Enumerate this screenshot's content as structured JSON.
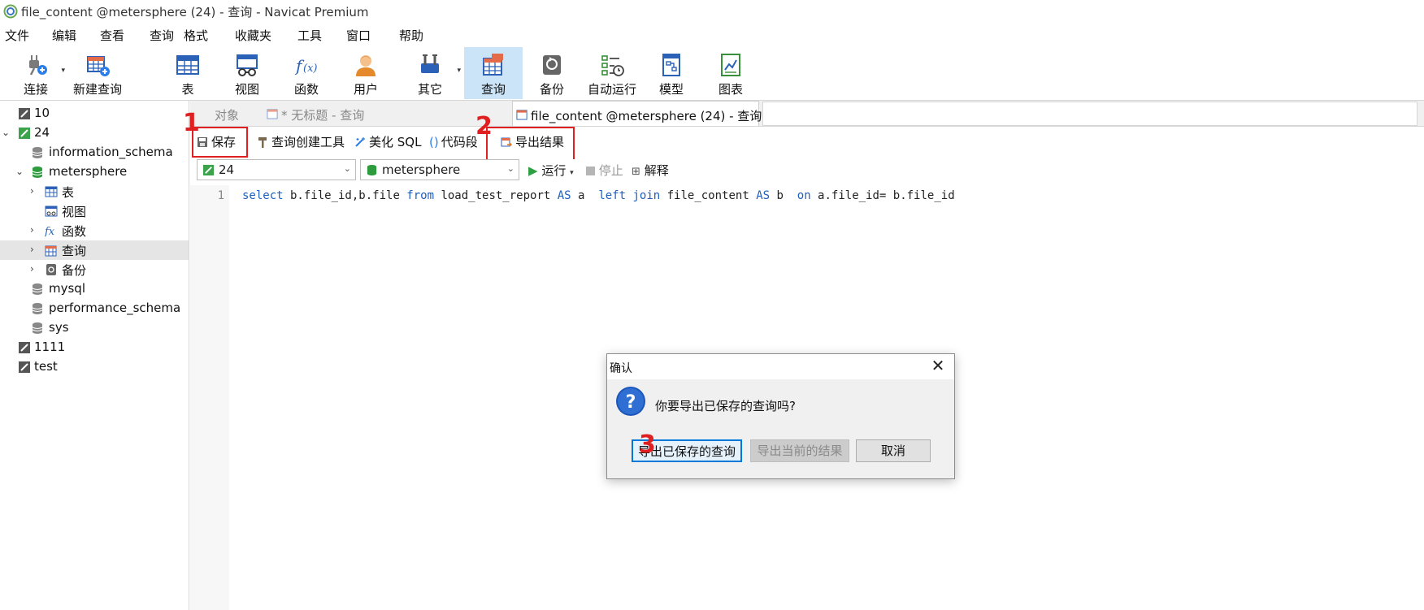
{
  "window": {
    "title": "file_content @metersphere (24) - 查询 - Navicat Premium"
  },
  "menu": [
    "文件",
    "编辑",
    "查看",
    "查询",
    "格式",
    "收藏夹",
    "工具",
    "窗口",
    "帮助"
  ],
  "toolbar": {
    "connect": "连接",
    "new_query": "新建查询",
    "table": "表",
    "view": "视图",
    "function": "函数",
    "user": "用户",
    "other": "其它",
    "query": "查询",
    "backup": "备份",
    "automation": "自动运行",
    "model": "模型",
    "chart": "图表"
  },
  "sidebar": {
    "items": [
      {
        "label": "10"
      },
      {
        "label": "24"
      },
      {
        "label": "information_schema"
      },
      {
        "label": "metersphere"
      },
      {
        "label": "表"
      },
      {
        "label": "视图"
      },
      {
        "label": "函数"
      },
      {
        "label": "查询"
      },
      {
        "label": "备份"
      },
      {
        "label": "mysql"
      },
      {
        "label": "performance_schema"
      },
      {
        "label": "sys"
      },
      {
        "label": "1111"
      },
      {
        "label": "test"
      }
    ]
  },
  "tabs": {
    "objects": "对象",
    "untitled": "* 无标题 - 查询",
    "current": "file_content @metersphere (24) - 查询"
  },
  "editor_toolbar": {
    "save": "保存",
    "query_builder": "查询创建工具",
    "beautify": "美化 SQL",
    "snippet": "代码段",
    "export": "导出结果"
  },
  "selectors": {
    "connection": "24",
    "database": "metersphere",
    "run": "运行",
    "stop": "停止",
    "explain": "解释"
  },
  "editor": {
    "line_number": "1",
    "code_tokens": [
      {
        "t": "select",
        "k": true
      },
      {
        "t": " b.file_id,b.file ",
        "k": false
      },
      {
        "t": "from",
        "k": true
      },
      {
        "t": " load_test_report ",
        "k": false
      },
      {
        "t": "AS",
        "k": true
      },
      {
        "t": " a  ",
        "k": false
      },
      {
        "t": "left join",
        "k": true
      },
      {
        "t": " file_content ",
        "k": false
      },
      {
        "t": "AS",
        "k": true
      },
      {
        "t": " b  ",
        "k": false
      },
      {
        "t": "on",
        "k": true
      },
      {
        "t": " a.file_id= b.file_id",
        "k": false
      }
    ]
  },
  "annotations": {
    "n1": "1",
    "n2": "2",
    "n3": "3"
  },
  "dialog": {
    "title": "确认",
    "message": "你要导出已保存的查询吗?",
    "btn_saved": "导出已保存的查询",
    "btn_current": "导出当前的结果",
    "btn_cancel": "取消"
  },
  "colors": {
    "accent": "#0078d7",
    "annotation_red": "#e02020",
    "keyword": "#1f5fbf",
    "selected_toolbar": "#cce4f7"
  }
}
